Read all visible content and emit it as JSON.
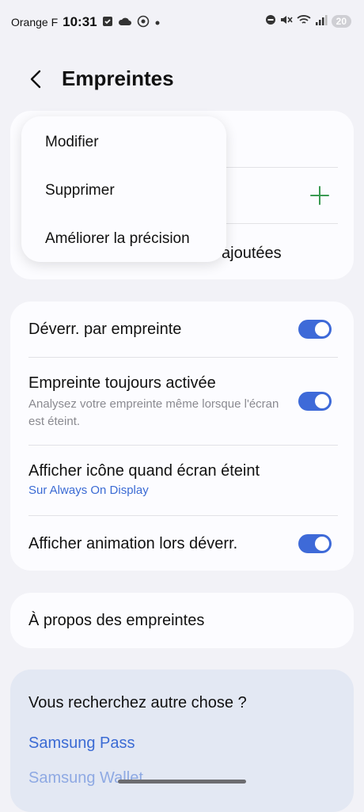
{
  "status_bar": {
    "carrier": "Orange F",
    "time": "10:31",
    "battery": "20"
  },
  "header": {
    "title": "Empreintes"
  },
  "fingerprints_card": {
    "add_icon": "plus-icon",
    "partial_text": "ajoutées"
  },
  "context_menu": {
    "items": [
      "Modifier",
      "Supprimer",
      "Améliorer la précision"
    ]
  },
  "settings": {
    "unlock_label": "Déverr. par empreinte",
    "unlock_on": true,
    "always_on_label": "Empreinte toujours activée",
    "always_on_desc": "Analysez votre empreinte même lorsque l'écran est éteint.",
    "always_on_on": true,
    "show_icon_label": "Afficher icône quand écran éteint",
    "show_icon_sub": "Sur Always On Display",
    "animation_label": "Afficher animation lors déverr.",
    "animation_on": true
  },
  "about": {
    "label": "À propos des empreintes"
  },
  "suggestions": {
    "heading": "Vous recherchez autre chose ?",
    "links": [
      "Samsung Pass",
      "Samsung Wallet"
    ]
  },
  "colors": {
    "accent": "#3e6ad8",
    "link": "#3b6bd4",
    "plus": "#3a9a52"
  }
}
